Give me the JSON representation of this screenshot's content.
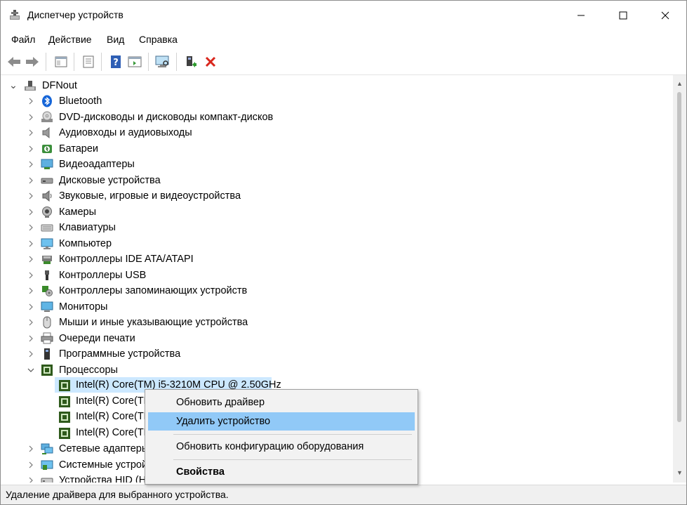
{
  "window": {
    "title": "Диспетчер устройств",
    "caption_buttons": [
      "minimize",
      "maximize",
      "close"
    ]
  },
  "menu": [
    "Файл",
    "Действие",
    "Вид",
    "Справка"
  ],
  "toolbar": {
    "buttons": [
      "back-icon",
      "forward-icon",
      "show-hide-console-tree-icon",
      "properties-icon",
      "help-icon",
      "action-pane-icon",
      "scan-hardware-icon",
      "update-driver-icon",
      "uninstall-icon"
    ]
  },
  "tree": {
    "root": "DFNout",
    "categories": [
      {
        "label": "Bluetooth",
        "icon": "bluetooth-icon",
        "expanded": false
      },
      {
        "label": "DVD-дисководы и дисководы компакт-дисков",
        "icon": "dvd-icon",
        "expanded": false
      },
      {
        "label": "Аудиовходы и аудиовыходы",
        "icon": "speaker-icon",
        "expanded": false
      },
      {
        "label": "Батареи",
        "icon": "battery-icon",
        "expanded": false
      },
      {
        "label": "Видеоадаптеры",
        "icon": "display-adapter-icon",
        "expanded": false
      },
      {
        "label": "Дисковые устройства",
        "icon": "disk-drive-icon",
        "expanded": false
      },
      {
        "label": "Звуковые, игровые и видеоустройства",
        "icon": "sound-icon",
        "expanded": false
      },
      {
        "label": "Камеры",
        "icon": "camera-icon",
        "expanded": false
      },
      {
        "label": "Клавиатуры",
        "icon": "keyboard-icon",
        "expanded": false
      },
      {
        "label": "Компьютер",
        "icon": "computer-icon",
        "expanded": false
      },
      {
        "label": "Контроллеры IDE ATA/ATAPI",
        "icon": "ide-controller-icon",
        "expanded": false
      },
      {
        "label": "Контроллеры USB",
        "icon": "usb-icon",
        "expanded": false
      },
      {
        "label": "Контроллеры запоминающих устройств",
        "icon": "storage-controller-icon",
        "expanded": false
      },
      {
        "label": "Мониторы",
        "icon": "monitor-icon",
        "expanded": false
      },
      {
        "label": "Мыши и иные указывающие устройства",
        "icon": "mouse-icon",
        "expanded": false
      },
      {
        "label": "Очереди печати",
        "icon": "printer-icon",
        "expanded": false
      },
      {
        "label": "Программные устройства",
        "icon": "software-device-icon",
        "expanded": false
      },
      {
        "label": "Процессоры",
        "icon": "processor-icon",
        "expanded": true
      }
    ],
    "processors": [
      "Intel(R) Core(TM) i5-3210M CPU @ 2.50GHz",
      "Intel(R) Core(TM",
      "Intel(R) Core(TM",
      "Intel(R) Core(TM"
    ],
    "after": [
      {
        "label": "Сетевые адаптеры",
        "icon": "network-adapter-icon"
      },
      {
        "label": "Системные устрой",
        "icon": "system-device-icon"
      },
      {
        "label": "Устройства HID (Н",
        "icon": "hid-icon"
      }
    ]
  },
  "context_menu": {
    "items": [
      {
        "label": "Обновить драйвер",
        "highlighted": false,
        "bold": false
      },
      {
        "label": "Удалить устройство",
        "highlighted": true,
        "bold": false
      },
      {
        "label": "Обновить конфигурацию оборудования",
        "highlighted": false,
        "bold": false
      },
      {
        "label": "Свойства",
        "highlighted": false,
        "bold": true
      }
    ]
  },
  "status": "Удаление драйвера для выбранного устройства.",
  "colors": {
    "selection": "#cce8ff",
    "menu_highlight": "#91c9f7",
    "uninstall_red": "#d9261c",
    "chip_green": "#4a7a2a"
  }
}
